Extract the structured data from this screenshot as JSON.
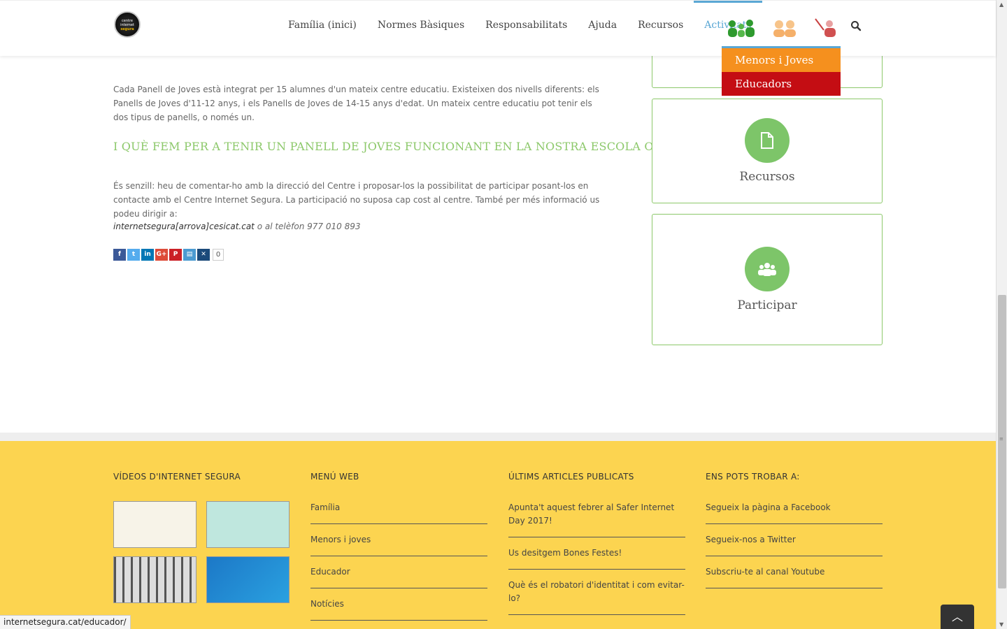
{
  "header": {
    "logo_text_line1": "centre",
    "logo_text_line2": "internet",
    "logo_text_line3": "segura",
    "nav": [
      {
        "label": "Família (inici)"
      },
      {
        "label": "Normes Bàsiques"
      },
      {
        "label": "Responsabilitats"
      },
      {
        "label": "Ajuda"
      },
      {
        "label": "Recursos"
      },
      {
        "label": "Activitats"
      }
    ],
    "active_color": "#5aa7d4"
  },
  "dropdown": {
    "items": [
      {
        "label": "Menors i Joves",
        "color": "#f5901e"
      },
      {
        "label": "Educadors",
        "color": "#c40d13"
      }
    ]
  },
  "main": {
    "paragraph1": "Cada Panell de Joves està integrat per 15 alumnes d'un mateix centre educatiu. Existeixen dos nivells diferents: els Panells de Joves d'11-12 anys, i els Panells de Joves de 14-15 anys d'edat. Un mateix centre educatiu pot tenir els dos tipus de panells, o només un.",
    "heading": "I QUÈ FEM PER A TENIR UN PANELL DE JOVES FUNCIONANT EN LA NOSTRA ESCOLA O INSTITUT?",
    "paragraph2": "És senzill: heu de comentar-ho amb la direcció del Centre i proposar-los la possibilitat de participar posant-los en contacte amb el Centre Internet Segura. La participació no suposa cap cost al centre. També per més informació us podeu dirigir a:",
    "contact_email": "internetsegura[arrova]cesicat.cat",
    "contact_phone": " o al telèfon 977 010 893",
    "share_count": "0",
    "accent_color": "#8cc86a"
  },
  "sidebar": {
    "recursos_label": "Recursos",
    "participar_label": "Participar"
  },
  "footer": {
    "bg_color": "#fcd450",
    "videos_title": "VÍDEOS D'INTERNET SEGURA",
    "menu_title": "MENÚ WEB",
    "menu_items": [
      "Família",
      "Menors i joves",
      "Educador",
      "Notícies"
    ],
    "articles_title": "ÚLTIMS ARTICLES PUBLICATS",
    "articles": [
      "Apunta't aquest febrer al Safer Internet Day 2017!",
      "Us desitgem Bones Festes!",
      "Què és el robatori d'identitat i com evitar-lo?"
    ],
    "social_title": "ENS POTS TROBAR A:",
    "social_items": [
      "Segueix la pàgina a Facebook",
      "Segueix-nos a Twitter",
      "Subscriu-te al canal Youtube"
    ]
  },
  "status_bar": {
    "url": "internetsegura.cat/educador/"
  },
  "icons": {
    "search": "search-icon",
    "to_top": "chevron-up-icon",
    "recursos": "document-icon",
    "participar": "group-icon"
  }
}
